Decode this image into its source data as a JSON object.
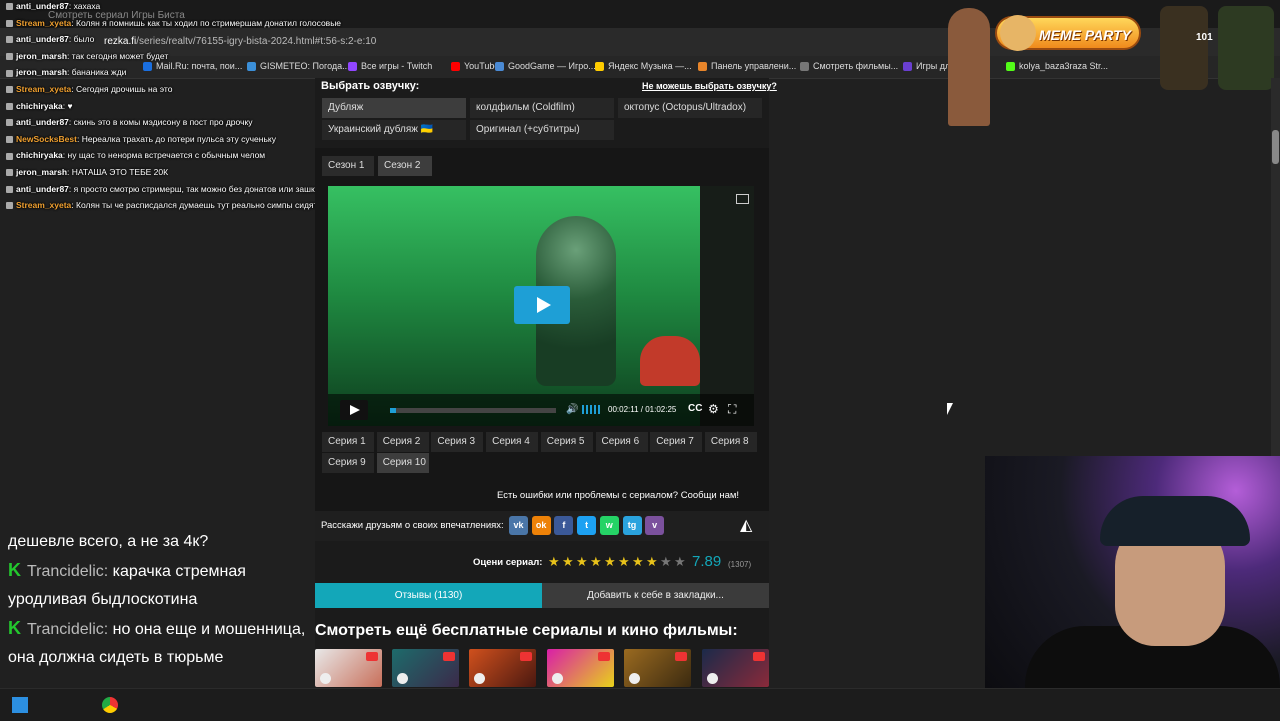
{
  "browser": {
    "tab_title": "Смотреть сериал Игры Биста",
    "url_domain": "rezka.fi",
    "url_path": "/series/realtv/76155-igry-bista-2024.html#t:56-s:2-e:10",
    "bookmarks": [
      {
        "label": "Mail.Ru: почта, пои...",
        "color": "#1a6fe0"
      },
      {
        "label": "GISMETEO: Погода...",
        "color": "#3b8fd8"
      },
      {
        "label": "Все игры - Twitch",
        "color": "#9146ff"
      },
      {
        "label": "YouTube",
        "color": "#ff0000"
      },
      {
        "label": "GoodGame — Игро...",
        "color": "#4a8ad4"
      },
      {
        "label": "Яндекс Музыка —...",
        "color": "#ffcc00"
      },
      {
        "label": "Панель управлени...",
        "color": "#e8852a"
      },
      {
        "label": "Смотреть фильмы...",
        "color": "#777777"
      },
      {
        "label": "Игры для",
        "color": "#6a3fd0"
      },
      {
        "label": "kolya_baza3raza Str...",
        "color": "#53fc18"
      }
    ]
  },
  "chat": [
    {
      "user": "anti_under87",
      "text": "хахаха",
      "color": "#ffffff"
    },
    {
      "user": "Stream_xyeta",
      "text": "Колян я помнишь как ты ходил по стримершам донатил голосовые",
      "color": "#f0a030"
    },
    {
      "user": "anti_under87",
      "text": "было",
      "color": "#ffffff"
    },
    {
      "user": "jeron_marsh",
      "text": "так сегодня может будет",
      "color": "#ffffff"
    },
    {
      "user": "jeron_marsh",
      "text": "бананика жди",
      "color": "#ffffff"
    },
    {
      "user": "Stream_xyeta",
      "text": "Сегодня дрочишь на это",
      "color": "#f0a030"
    },
    {
      "user": "chichiryaka",
      "text": "♥",
      "color": "#ffffff"
    },
    {
      "user": "anti_under87",
      "text": "скинь это в комы мэдисону в пост про дрочку",
      "color": "#ffffff"
    },
    {
      "user": "NewSocksBest",
      "text": "Нереалка трахать до потери пульса эту сученьку",
      "color": "#f0a030"
    },
    {
      "user": "chichiryaka",
      "text": "ну щас то ненорма встречается с обычным челом",
      "color": "#ffffff"
    },
    {
      "user": "jeron_marsh",
      "text": "НАТАША ЭТО ТЕБЕ 20К",
      "color": "#ffffff"
    },
    {
      "user": "anti_under87",
      "text": "я просто смотрю стримерш, так можно без донатов или зашквар ?",
      "color": "#ffffff"
    },
    {
      "user": "Stream_xyeta",
      "text": "Колян ты че расписдался думаешь тут реально симпы сидят",
      "color": "#f0a030"
    }
  ],
  "bigchat": {
    "line0": "дешевле всего, а не за 4к?",
    "msg1_user": "Trancidelic:",
    "msg1_text": "карачка стремная уродливая быдлоскотина",
    "msg2_user": "Trancidelic:",
    "msg2_text": "но она еще и мошенница, она должна сидеть в тюрьме"
  },
  "voice": {
    "heading": "Выбрать озвучку:",
    "help_link": "Не можешь выбрать озвучку?",
    "options": [
      "Дубляж",
      "колдфильм (Coldfilm)",
      "октопус (Octopus/Ultradox)",
      "Украинский дубляж 🇺🇦",
      "Оригинал (+субтитры)"
    ],
    "selected": "Дубляж"
  },
  "seasons": [
    "Сезон 1",
    "Сезон 2"
  ],
  "selected_season": "Сезон 2",
  "player": {
    "time_current": "00:02:11",
    "time_total": "01:02:25",
    "progress": 0.035,
    "cc_label": "CC"
  },
  "episodes": [
    "Серия 1",
    "Серия 2",
    "Серия 3",
    "Серия 4",
    "Серия 5",
    "Серия 6",
    "Серия 7",
    "Серия 8",
    "Серия 9",
    "Серия 10"
  ],
  "selected_episode": "Серия 10",
  "report_text": "Есть ошибки или проблемы с сериалом? Сообщи нам!",
  "share": {
    "label": "Расскажи друзьям о своих впечатлениях:",
    "networks": [
      {
        "name": "vk-icon",
        "glyph": "vk",
        "color": "#4a76a8"
      },
      {
        "name": "ok-icon",
        "glyph": "ok",
        "color": "#ee8208"
      },
      {
        "name": "facebook-icon",
        "glyph": "f",
        "color": "#3b5998"
      },
      {
        "name": "twitter-icon",
        "glyph": "t",
        "color": "#1da1f2"
      },
      {
        "name": "whatsapp-icon",
        "glyph": "w",
        "color": "#25d366"
      },
      {
        "name": "telegram-icon",
        "glyph": "tg",
        "color": "#2aa3de"
      },
      {
        "name": "viber-icon",
        "glyph": "v",
        "color": "#7b519d"
      }
    ]
  },
  "rating": {
    "label": "Оцени сериал:",
    "value": "7.89",
    "votes": "(1307)",
    "stars_filled": 8,
    "stars_total": 10
  },
  "buttons": {
    "reviews": "Отзывы (1130)",
    "bookmark": "Добавить к себе в закладки..."
  },
  "more_heading": "Смотреть ещё бесплатные сериалы и кино фильмы:",
  "overlay": {
    "meme_party": "MEME PARTY",
    "badge_count": "101"
  }
}
